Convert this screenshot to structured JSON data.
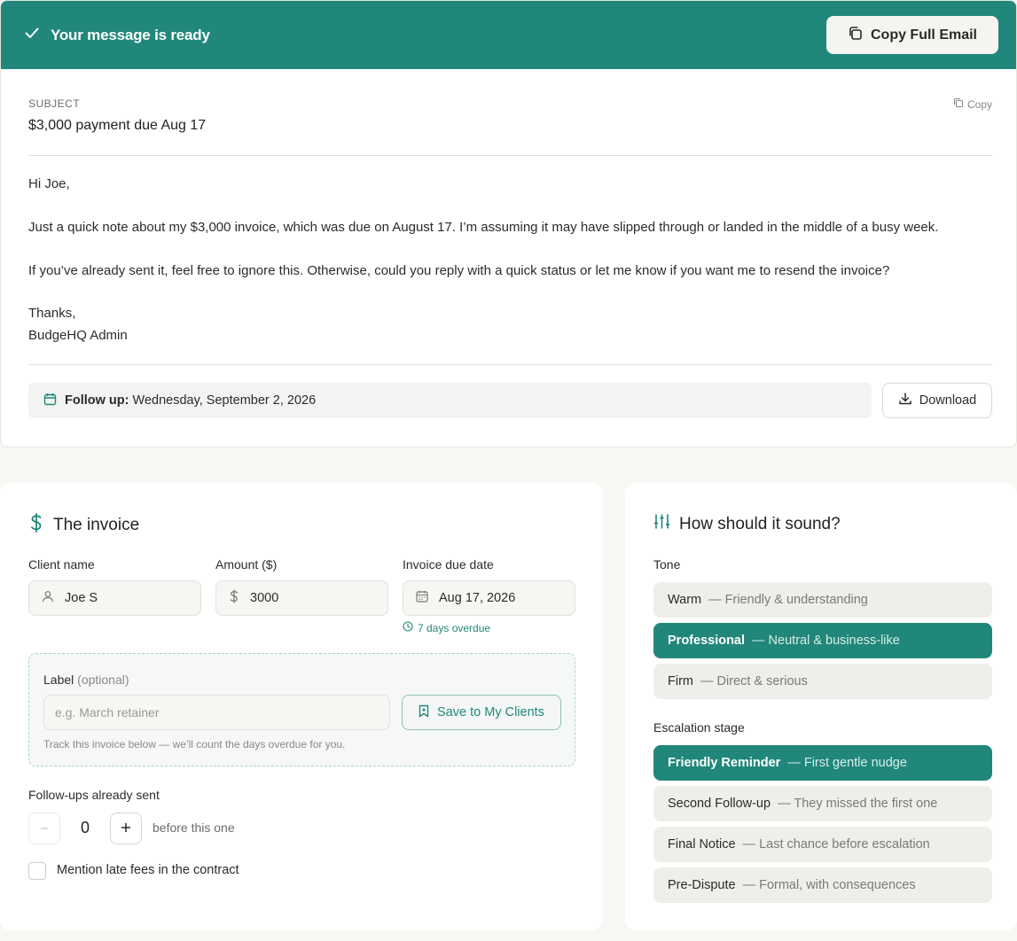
{
  "banner": {
    "title": "Your message is ready",
    "copy_full_label": "Copy Full Email"
  },
  "email": {
    "subject_label": "SUBJECT",
    "subject": "$3,000 payment due Aug 17",
    "copy_label": "Copy",
    "greeting": "Hi Joe,",
    "paragraph1": "Just a quick note about my $3,000 invoice, which was due on August 17. I’m assuming it may have slipped through or landed in the middle of a busy week.",
    "paragraph2": "If you’ve already sent it, feel free to ignore this. Otherwise, could you reply with a quick status or let me know if you want me to resend the invoice?",
    "signoff": "Thanks,",
    "signature": "BudgeHQ Admin",
    "followup_prefix": "Follow up:",
    "followup_date": "Wednesday, September 2, 2026",
    "download_label": "Download"
  },
  "invoice": {
    "title": "The invoice",
    "client_label": "Client name",
    "client_value": "Joe S",
    "amount_label": "Amount ($)",
    "amount_value": "3000",
    "due_label": "Invoice due date",
    "due_value": "Aug 17, 2026",
    "overdue_text": "7 days overdue",
    "label_title": "Label",
    "label_optional": "(optional)",
    "label_placeholder": "e.g. March retainer",
    "save_label": "Save to My Clients",
    "label_hint": "Track this invoice below — we’ll count the days overdue for you.",
    "followups_label": "Follow-ups already sent",
    "followups_value": "0",
    "followups_suffix": "before this one",
    "late_fees_label": "Mention late fees in the contract",
    "late_fees_checked": false
  },
  "sound": {
    "title": "How should it sound?",
    "tone_label": "Tone",
    "tones": [
      {
        "name": "Warm",
        "desc": "— Friendly & understanding",
        "selected": false
      },
      {
        "name": "Professional",
        "desc": "— Neutral & business-like",
        "selected": true
      },
      {
        "name": "Firm",
        "desc": "— Direct & serious",
        "selected": false
      }
    ],
    "stage_label": "Escalation stage",
    "stages": [
      {
        "name": "Friendly Reminder",
        "desc": "— First gentle nudge",
        "selected": true
      },
      {
        "name": "Second Follow-up",
        "desc": "— They missed the first one",
        "selected": false
      },
      {
        "name": "Final Notice",
        "desc": "— Last chance before escalation",
        "selected": false
      },
      {
        "name": "Pre-Dispute",
        "desc": "— Formal, with consequences",
        "selected": false
      }
    ]
  },
  "colors": {
    "accent": "#20877a",
    "background": "#f8f7f4"
  }
}
